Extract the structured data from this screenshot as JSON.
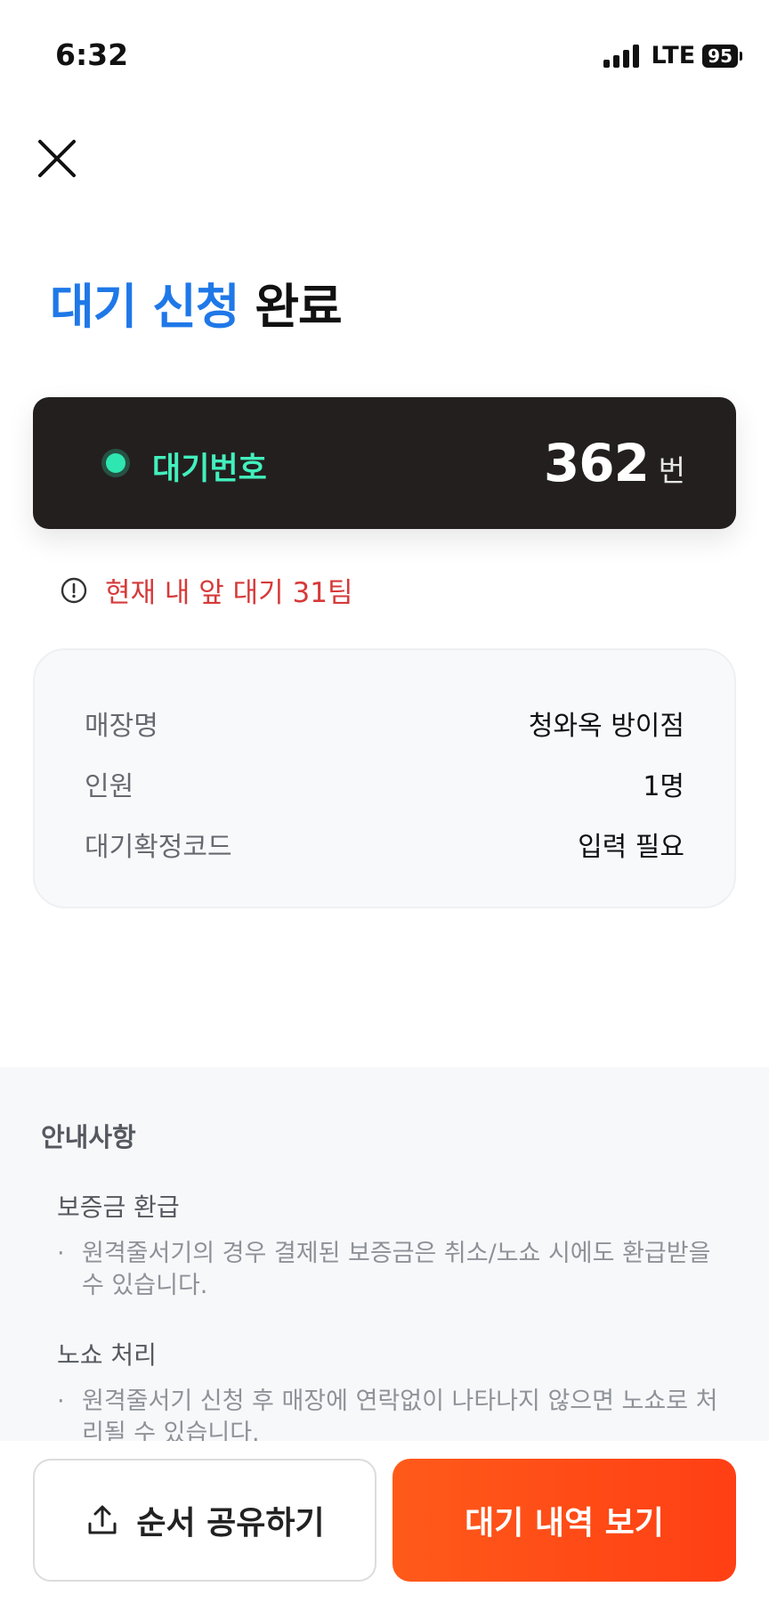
{
  "status_bar": {
    "time": "6:32",
    "network": "LTE",
    "battery": "95"
  },
  "header": {
    "close_icon": "close-icon",
    "title_accent": "대기 신청",
    "title_rest": " 완료"
  },
  "wait_card": {
    "label": "대기번호",
    "number": "362",
    "unit": "번"
  },
  "ahead_notice": {
    "icon": "exclamation-circle-icon",
    "text": "현재 내 앞 대기 31팀"
  },
  "info": {
    "rows": [
      {
        "key": "매장명",
        "value": "청와옥 방이점"
      },
      {
        "key": "인원",
        "value": "1명"
      },
      {
        "key": "대기확정코드",
        "value": "입력 필요"
      }
    ]
  },
  "notice": {
    "title": "안내사항",
    "sections": [
      {
        "heading": "보증금 환급",
        "text": "원격줄서기의 경우 결제된 보증금은 취소/노쇼 시에도 환급받을 수 있습니다."
      },
      {
        "heading": "노쇼 처리",
        "text": "원격줄서기 신청 후 매장에 연락없이 나타나지 않으면 노쇼로 처리될 수 있습니다."
      }
    ]
  },
  "bottom": {
    "share_label": "순서 공유하기",
    "share_icon": "share-upload-icon",
    "history_label": "대기 내역 보기"
  },
  "colors": {
    "accent_blue": "#1f78e8",
    "card_dark": "#231f1f",
    "mint": "#42f0bd",
    "alert_red": "#d63a3a",
    "cta_orange": "#ff4a17"
  }
}
